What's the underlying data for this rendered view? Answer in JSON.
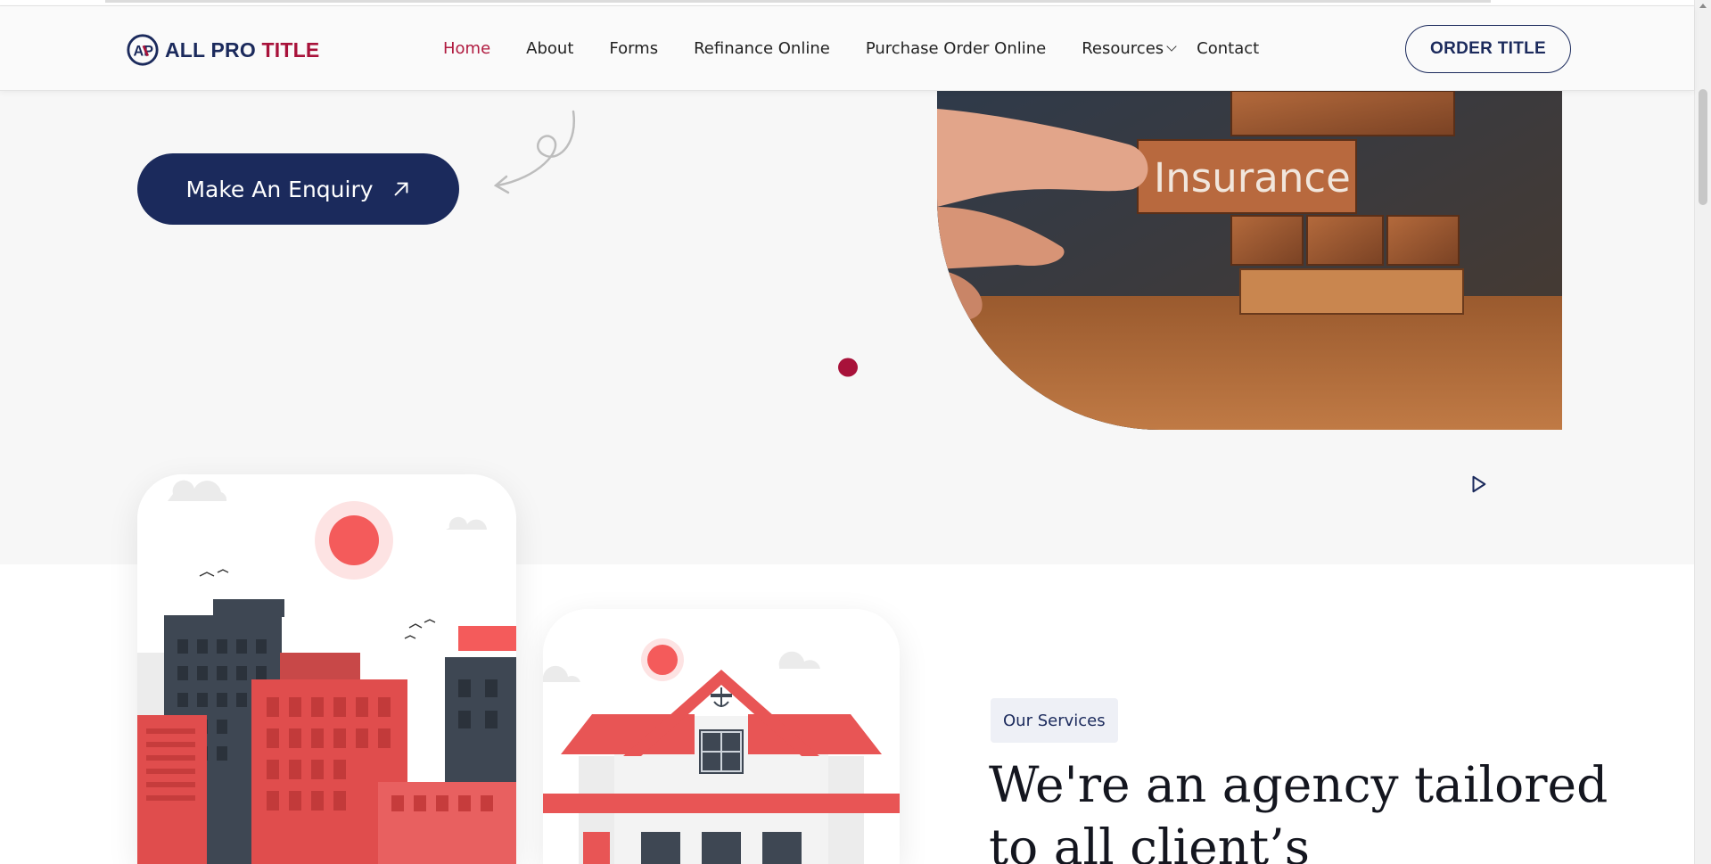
{
  "brand": {
    "logo_initials": "AP",
    "name_part1": "ALL PRO",
    "name_part2": "TITLE",
    "primary_color": "#1b2a5c",
    "accent_color": "#a8123a"
  },
  "nav": {
    "items": [
      {
        "label": "Home",
        "active": true
      },
      {
        "label": "About"
      },
      {
        "label": "Forms"
      },
      {
        "label": "Refinance Online"
      },
      {
        "label": "Purchase Order Online"
      },
      {
        "label": "Resources",
        "has_dropdown": true
      },
      {
        "label": "Contact"
      }
    ],
    "cta_label": "ORDER TITLE"
  },
  "hero": {
    "enquiry_label": "Make An Enquiry",
    "enquiry_icon": "arrow-up-right-icon",
    "image_text": "Insurance",
    "play_icon": "play-icon"
  },
  "services": {
    "tag": "Our Services",
    "heading": "We're an agency tailored to all client’s"
  }
}
